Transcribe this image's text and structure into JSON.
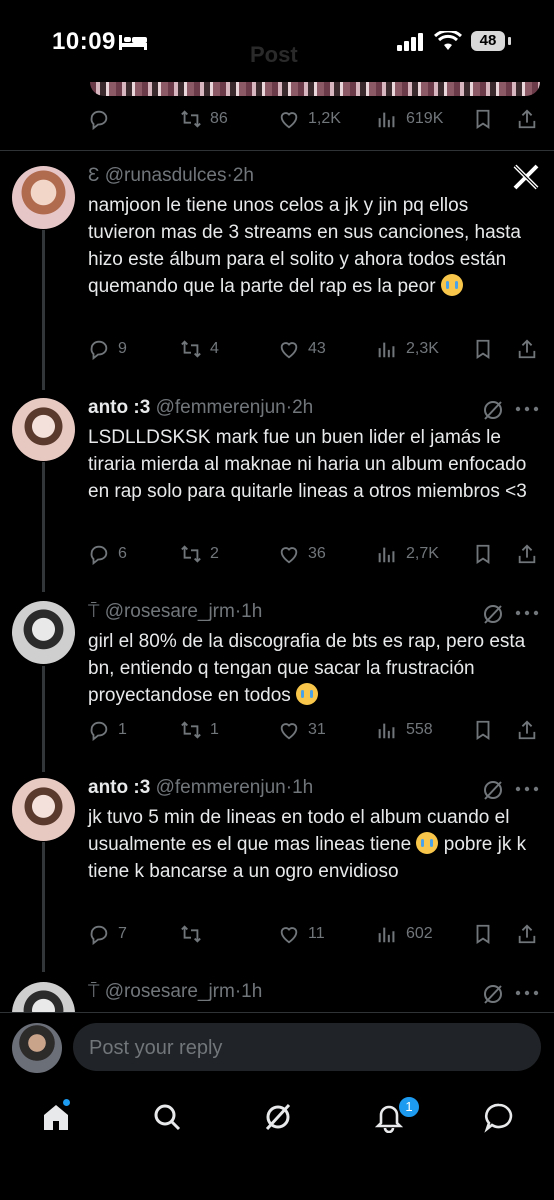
{
  "status": {
    "time": "10:09",
    "battery": "48",
    "header_title": "Post"
  },
  "top_post_actions": {
    "retweets": "86",
    "likes": "1,2K",
    "views": "619K"
  },
  "replies": [
    {
      "name": "",
      "name_glyph": "Ɛ",
      "handle": "@runasdulces",
      "time": "2h",
      "text": "namjoon le tiene unos celos a jk y jin pq ellos tuvieron mas de 3 streams en sus canciones, hasta hizo este álbum para el solito y ahora todos están quemando que la parte del rap es la peor",
      "replies": "9",
      "retweets": "4",
      "likes": "43",
      "views": "2,3K"
    },
    {
      "name": "anto :3",
      "handle": "@femmerenjun",
      "time": "2h",
      "text": "LSDLLDSKSK mark fue un buen lider el jamás le tiraria mierda al maknae ni haria un album enfocado en rap solo para quitarle lineas a otros miembros <3",
      "replies": "6",
      "retweets": "2",
      "likes": "36",
      "views": "2,7K"
    },
    {
      "name": "",
      "name_glyph": "⍑",
      "handle": "@rosesare_jrm",
      "time": "1h",
      "text": "girl el 80% de la discografia de bts es rap, pero esta bn, entiendo q tengan que sacar la frustración proyectandose en todos",
      "replies": "1",
      "retweets": "1",
      "likes": "31",
      "views": "558"
    },
    {
      "name": "anto :3",
      "handle": "@femmerenjun",
      "time": "1h",
      "text_a": "jk tuvo 5 min de lineas en todo el album cuando el usualmente es el que mas lineas tiene",
      "text_b": "pobre jk k tiene k bancarse a un ogro envidioso",
      "replies": "7",
      "retweets": "",
      "likes": "11",
      "views": "602"
    },
    {
      "name": "",
      "name_glyph": "⍑",
      "handle": "@rosesare_jrm",
      "time": "1h"
    }
  ],
  "reply_box": {
    "placeholder": "Post your reply"
  },
  "tabs": {
    "notifications_badge": "1"
  },
  "icons": [
    "reply-icon",
    "retweet-icon",
    "like-icon",
    "views-icon",
    "bookmark-icon",
    "share-icon",
    "grok-icon",
    "more-icon",
    "x-logo-icon",
    "home-icon",
    "search-icon",
    "grok-tab-icon",
    "bell-icon",
    "messages-icon"
  ]
}
